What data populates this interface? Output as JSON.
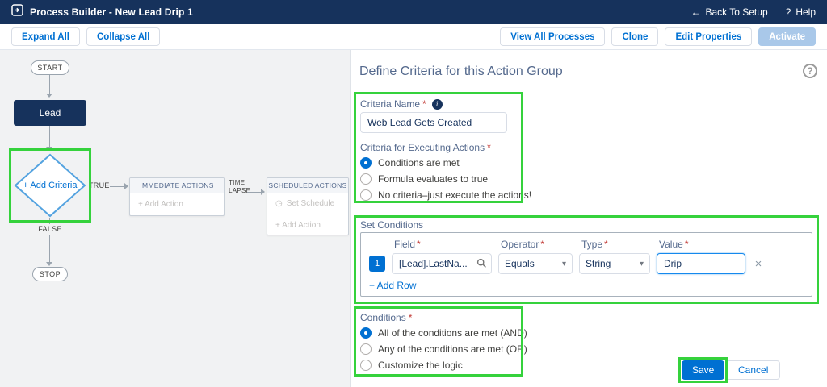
{
  "ui": {
    "required": "*"
  },
  "icons": {
    "chevron_down": "▾",
    "clock": "◷",
    "info": "i",
    "back_arrow": "←",
    "help_q": "?",
    "delete_x": "×"
  },
  "header": {
    "title": "Process Builder - New Lead Drip 1",
    "back": "Back To Setup",
    "help": "Help"
  },
  "toolbar": {
    "expand_all": "Expand All",
    "collapse_all": "Collapse All",
    "view_all_processes": "View All Processes",
    "clone": "Clone",
    "edit_properties": "Edit Properties",
    "activate": "Activate"
  },
  "canvas": {
    "start": "START",
    "object_node": "Lead",
    "add_criteria": "+ Add Criteria",
    "true_label": "TRUE",
    "false_label": "FALSE",
    "time_lapse": "TIME LAPSE",
    "immediate": {
      "title": "IMMEDIATE ACTIONS",
      "add_action": "+ Add Action"
    },
    "scheduled": {
      "title": "SCHEDULED ACTIONS",
      "set_schedule": "Set Schedule",
      "add_action": "+ Add Action"
    },
    "stop": "STOP"
  },
  "panel": {
    "title": "Define Criteria for this Action Group",
    "criteria_name_label": "Criteria Name",
    "criteria_name_value": "Web Lead Gets Created",
    "executing_label": "Criteria for Executing Actions",
    "executing_options": [
      {
        "label": "Conditions are met",
        "selected": true
      },
      {
        "label": "Formula evaluates to true",
        "selected": false
      },
      {
        "label": "No criteria–just execute the actions!",
        "selected": false
      }
    ],
    "set_conditions_label": "Set Conditions",
    "columns": {
      "field": "Field",
      "operator": "Operator",
      "type": "Type",
      "value": "Value"
    },
    "row": {
      "index": "1",
      "field": "[Lead].LastNa...",
      "operator": "Equals",
      "type": "String",
      "value": "Drip"
    },
    "add_row": "+ Add Row",
    "conditions_label": "Conditions",
    "conditions_options": [
      {
        "label": "All of the conditions are met (AND)",
        "selected": true
      },
      {
        "label": "Any of the conditions are met (OR)",
        "selected": false
      },
      {
        "label": "Customize the logic",
        "selected": false
      }
    ],
    "save": "Save",
    "cancel": "Cancel"
  },
  "colors": {
    "header_bg": "#16325c",
    "accent": "#0070d2",
    "annotation_green": "#35d23c"
  }
}
